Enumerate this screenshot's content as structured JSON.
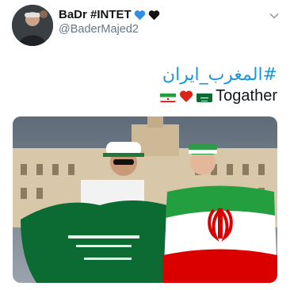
{
  "tweet": {
    "display_name": "BaDr #INTET",
    "handle": "@BaderMajed2",
    "hashtag": "#المغرب_ايران",
    "text": "Togather",
    "emojis": [
      "iran-flag",
      "red-heart",
      "saudi-flag"
    ],
    "name_emojis": [
      "blue-heart",
      "black-heart"
    ]
  },
  "colors": {
    "link": "#1b95e0",
    "secondary": "#657786",
    "saudi_green": "#0b6b32",
    "iran_green": "#239f40",
    "iran_red": "#da0000"
  }
}
